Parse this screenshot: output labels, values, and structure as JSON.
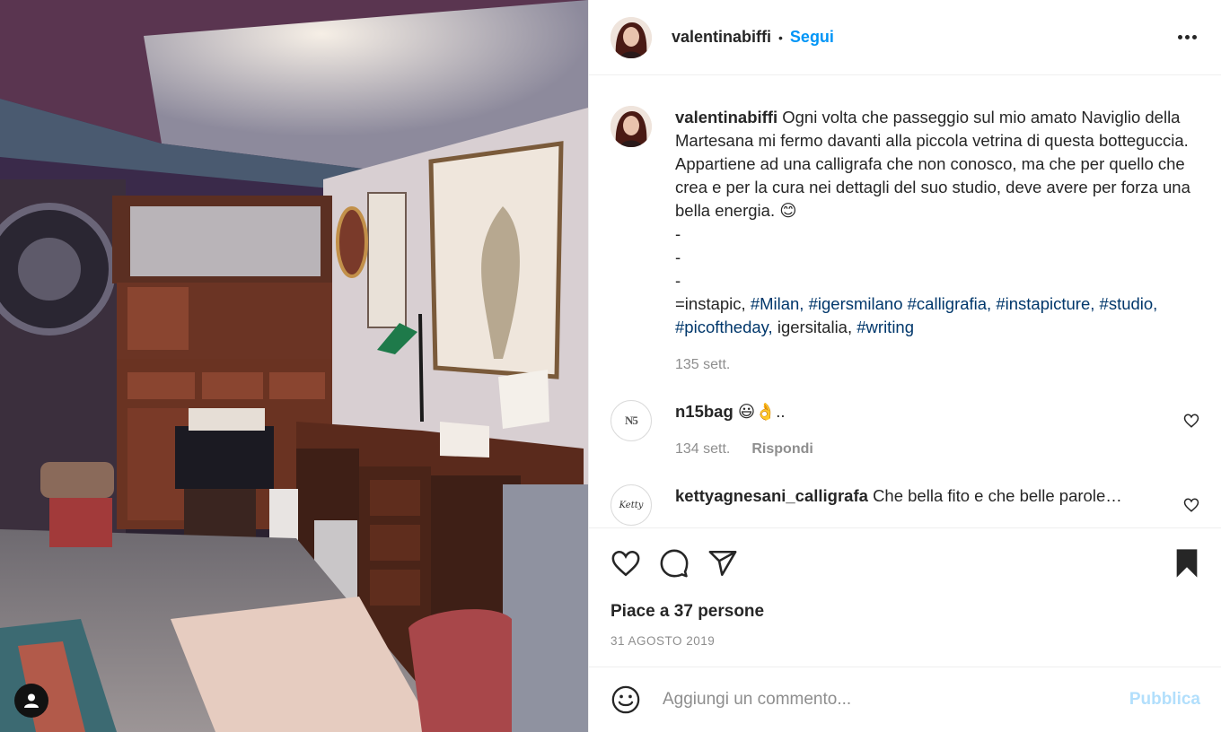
{
  "post": {
    "username": "valentinabiffi",
    "follow_label": "Segui",
    "separator": "•",
    "more_icon": "more-horizontal-icon"
  },
  "caption": {
    "username": "valentinabiffi",
    "text_line1": "Ogni volta che passeggio sul mio amato Naviglio della Martesana mi fermo davanti alla piccola vetrina di questa botteguccia. Appartiene ad una calligrafa che non conosco, ma che per quello che crea e per la cura nei dettagli del suo studio, deve avere per forza una bella energia. 😊",
    "dash1": "-",
    "dash2": "-",
    "dash3": "-",
    "hashtags": [
      {
        "text": "=instapic,",
        "is_tag": false
      },
      {
        "text": "#Milan,",
        "is_tag": true
      },
      {
        "text": "#igersmilano",
        "is_tag": true
      },
      {
        "text": "#calligrafia,",
        "is_tag": true
      },
      {
        "text": "#instapicture,",
        "is_tag": true
      },
      {
        "text": "#studio,",
        "is_tag": true
      },
      {
        "text": "#picoftheday,",
        "is_tag": true
      },
      {
        "text": "igersitalia,",
        "is_tag": false
      },
      {
        "text": "#writing",
        "is_tag": true
      }
    ],
    "time": "135 sett."
  },
  "comments": [
    {
      "username": "n15bag",
      "text": "😃👌..",
      "avatar_text": "N5",
      "time": "134 sett.",
      "reply_label": "Rispondi"
    },
    {
      "username": "kettyagnesani_calligrafa",
      "text": "Che bella fito e che belle parole…",
      "avatar_text": "Ketty"
    }
  ],
  "actions": {
    "like_icon": "heart-icon",
    "comment_icon": "comment-icon",
    "share_icon": "share-icon",
    "save_icon": "bookmark-icon",
    "likes_text": "Piace a 37 persone",
    "date": "31 AGOSTO 2019"
  },
  "add_comment": {
    "placeholder": "Aggiungi un commento...",
    "publish_label": "Pubblica",
    "emoji_icon": "emoji-icon"
  },
  "colors": {
    "link_blue": "#0095f6",
    "hashtag_blue": "#00376b",
    "muted_gray": "#8e8e8e",
    "publish_disabled": "#b2dffc"
  }
}
